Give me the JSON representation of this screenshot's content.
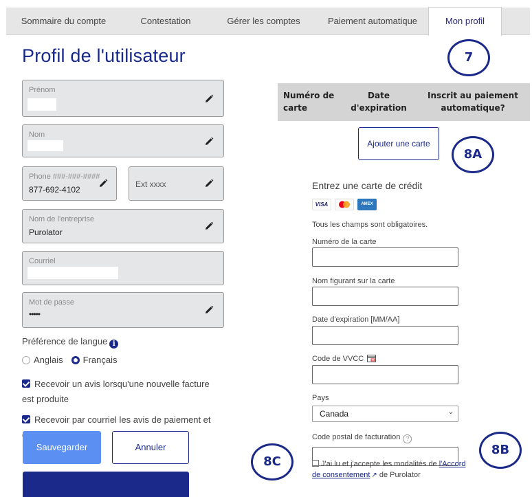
{
  "tabs": [
    {
      "label": "Sommaire du compte"
    },
    {
      "label": "Contestation"
    },
    {
      "label": "Gérer les comptes"
    },
    {
      "label": "Paiement automatique"
    },
    {
      "label": "Mon profil"
    }
  ],
  "page_title": "Profil de l'utilisateur",
  "form": {
    "first_name": {
      "label": "Prénom",
      "value": ""
    },
    "last_name": {
      "label": "Nom",
      "value": ""
    },
    "phone": {
      "label": "Phone ###-###-####",
      "value": "877-692-4102"
    },
    "ext": {
      "label": "Ext xxxx"
    },
    "company": {
      "label": "Nom de l'entreprise",
      "value": "Purolator"
    },
    "email": {
      "label": "Courriel",
      "value": ""
    },
    "password": {
      "label": "Mot de passe",
      "value": "•••••"
    }
  },
  "language": {
    "title": "Préférence de langue",
    "options": [
      "Anglais",
      "Français"
    ],
    "selected": "Français"
  },
  "notifications": {
    "invoice": "Recevoir un avis lorsqu'une nouvelle facture est produite",
    "payment": "Recevoir par courriel les avis de paiement et de remise"
  },
  "buttons": {
    "save": "Sauvegarder",
    "cancel": "Annuler",
    "add_card": "Ajouter une carte"
  },
  "card_table": {
    "headers": [
      "Numéro de carte",
      "Date d'expiration",
      "Inscrit au paiement automatique?"
    ]
  },
  "credit_card_form": {
    "title": "Entrez une carte de crédit",
    "card_brands": [
      "VISA",
      "mastercard",
      "AMEX"
    ],
    "required_note": "Tous les champs sont obligatoires.",
    "card_number_label": "Numéro de la carte",
    "name_label": "Nom figurant sur la carte",
    "expiry_label": "Date d'expiration [MM/AA]",
    "cvv_label": "Code de VVCC",
    "country_label": "Pays",
    "country_value": "Canada",
    "postal_label": "Code postal de facturation",
    "consent_prefix": "J'ai lu et j'accepte les modalités de ",
    "consent_link": "l'Accord de consentement",
    "consent_suffix": " de Purolator"
  },
  "markers": [
    "7",
    "8A",
    "8B",
    "8C"
  ],
  "colors": {
    "brand_navy": "#1b2a8a",
    "save_blue": "#5b8ff2",
    "field_bg": "#e5e6e8"
  }
}
